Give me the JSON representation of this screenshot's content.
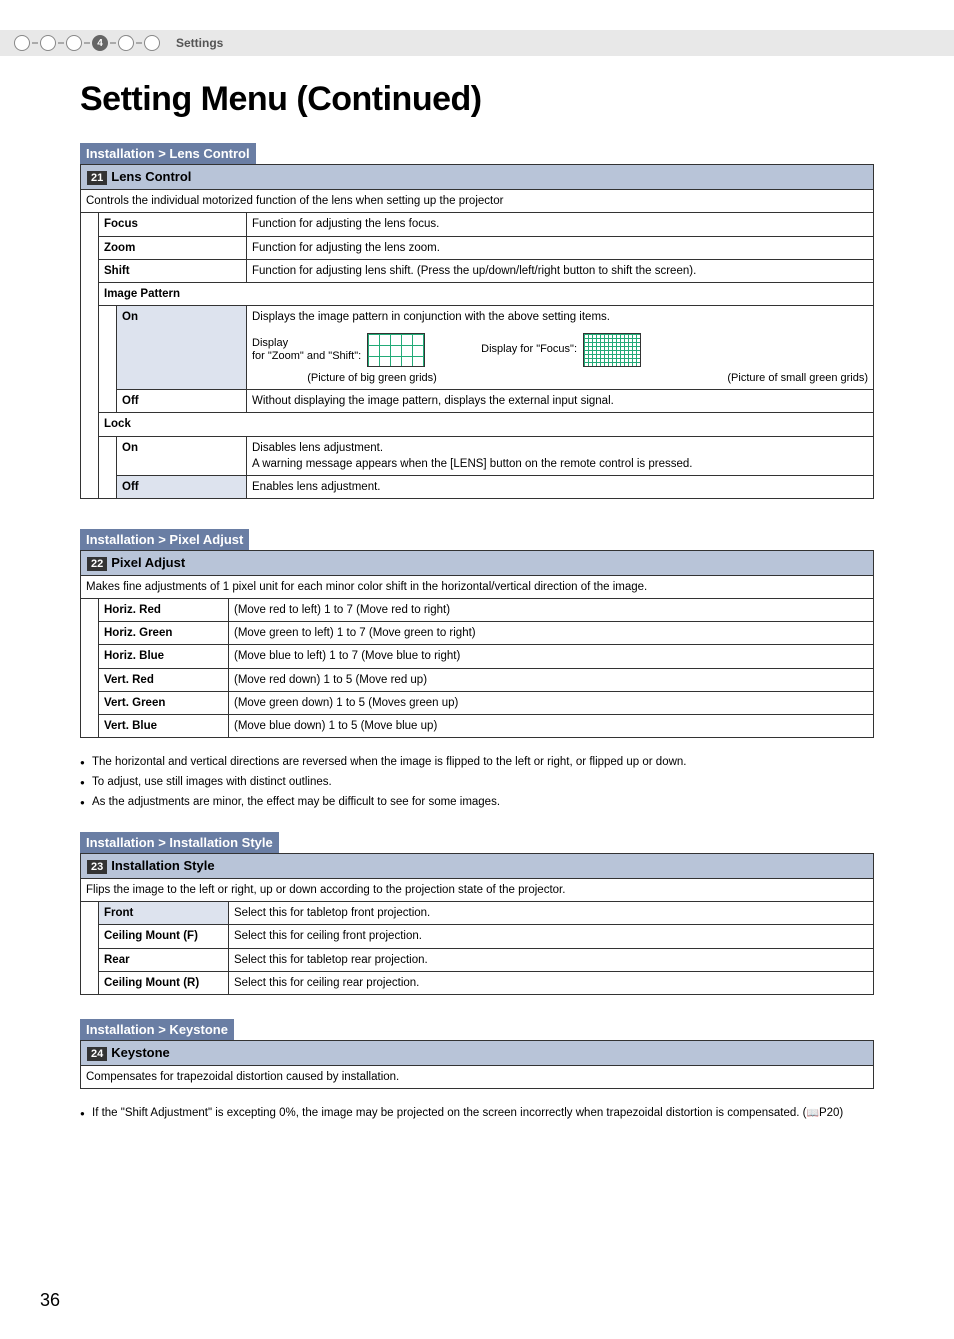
{
  "header": {
    "step_active": "4",
    "label": "Settings"
  },
  "title": "Setting Menu (Continued)",
  "lens_control": {
    "section_title": "Installation > Lens Control",
    "number": "21",
    "heading": "Lens Control",
    "desc": "Controls the individual motorized function of the lens when setting up the projector",
    "rows": [
      {
        "label": "Focus",
        "desc": "Function for adjusting the lens focus."
      },
      {
        "label": "Zoom",
        "desc": "Function for adjusting the lens zoom."
      },
      {
        "label": "Shift",
        "desc": "Function for adjusting lens shift. (Press the up/down/left/right button to shift the screen)."
      }
    ],
    "image_pattern": {
      "label": "Image Pattern",
      "on": {
        "label": "On",
        "line1": "Displays the image pattern in conjunction with the above setting items.",
        "display_label": "Display\nfor \"Zoom\" and \"Shift\":",
        "focus_label": "Display for \"Focus\":",
        "caption_big": "(Picture of big green grids)",
        "caption_small": "(Picture of small green grids)"
      },
      "off": {
        "label": "Off",
        "desc": "Without displaying the image pattern, displays the external input signal."
      }
    },
    "lock": {
      "label": "Lock",
      "on": {
        "label": "On",
        "desc": "Disables lens adjustment.\nA warning message appears when the [LENS] button on the remote control is pressed."
      },
      "off": {
        "label": "Off",
        "desc": "Enables lens adjustment."
      }
    }
  },
  "pixel_adjust": {
    "section_title": "Installation > Pixel Adjust",
    "number": "22",
    "heading": "Pixel Adjust",
    "desc": "Makes fine adjustments of 1 pixel unit for each minor color shift in the horizontal/vertical direction of the image.",
    "rows": [
      {
        "label": "Horiz. Red",
        "desc": "(Move red to left) 1 to 7 (Move red to right)"
      },
      {
        "label": "Horiz. Green",
        "desc": "(Move green to left) 1 to 7 (Move green to right)"
      },
      {
        "label": "Horiz. Blue",
        "desc": "(Move blue to left) 1 to 7 (Move blue to right)"
      },
      {
        "label": "Vert. Red",
        "desc": "(Move red down) 1 to 5 (Move red up)"
      },
      {
        "label": "Vert. Green",
        "desc": "(Move green down) 1 to 5 (Moves green up)"
      },
      {
        "label": "Vert. Blue",
        "desc": "(Move blue down) 1 to 5 (Move blue up)"
      }
    ],
    "notes": [
      "The horizontal and vertical directions are reversed when the image is flipped to the left or right, or flipped up or down.",
      "To adjust, use still images with distinct outlines.",
      "As the adjustments are minor, the effect may be difficult to see for some images."
    ]
  },
  "installation_style": {
    "section_title": "Installation > Installation Style",
    "number": "23",
    "heading": "Installation Style",
    "desc": "Flips the image to the left or right, up or down according to the projection state of the projector.",
    "rows": [
      {
        "label": "Front",
        "desc": "Select this for tabletop front projection.",
        "hl": true
      },
      {
        "label": "Ceiling Mount (F)",
        "desc": "Select this for ceiling front projection."
      },
      {
        "label": "Rear",
        "desc": "Select this for tabletop rear projection."
      },
      {
        "label": "Ceiling Mount (R)",
        "desc": "Select this for ceiling rear projection."
      }
    ]
  },
  "keystone": {
    "section_title": "Installation > Keystone",
    "number": "24",
    "heading": "Keystone",
    "desc": "Compensates for trapezoidal distortion caused by installation.",
    "note": "If the \"Shift Adjustment\" is excepting 0%, the image may be projected on the screen incorrectly when trapezoidal distortion  is compensated. (",
    "ref": "P20)"
  },
  "page_number": "36"
}
